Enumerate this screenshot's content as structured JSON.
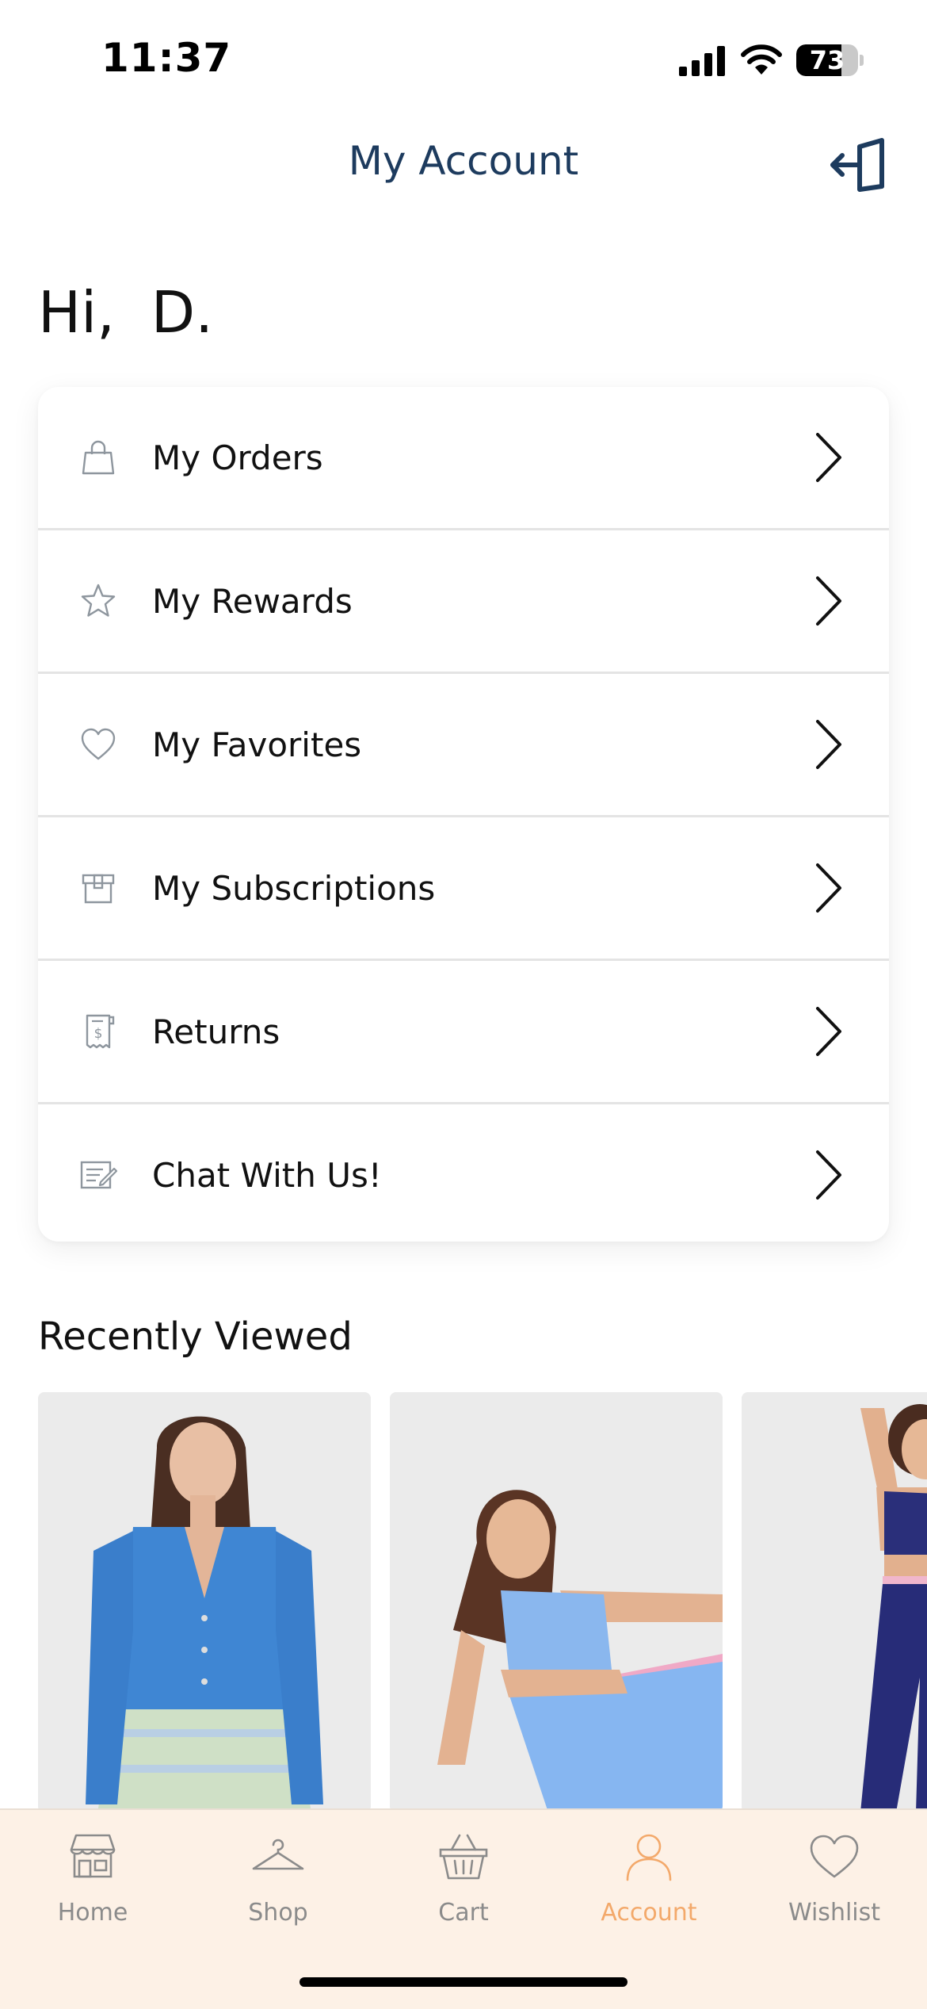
{
  "status_bar": {
    "time": "11:37",
    "battery_level": "73",
    "battery_fraction": 0.73
  },
  "header": {
    "title": "My Account",
    "logout_icon": "logout-icon"
  },
  "greeting": "Hi,  D.",
  "menu": {
    "items": [
      {
        "label": "My Orders",
        "icon": "shopping-bag-icon"
      },
      {
        "label": "My Rewards",
        "icon": "star-icon"
      },
      {
        "label": "My Favorites",
        "icon": "heart-icon"
      },
      {
        "label": "My Subscriptions",
        "icon": "box-icon"
      },
      {
        "label": "Returns",
        "icon": "receipt-icon"
      },
      {
        "label": "Chat With Us!",
        "icon": "chat-form-icon"
      }
    ]
  },
  "recently_viewed": {
    "title": "Recently Viewed",
    "products": [
      {
        "image": "product-blue-cardigan"
      },
      {
        "image": "product-light-blue-activewear"
      },
      {
        "image": "product-navy-activewear"
      }
    ]
  },
  "tab_bar": {
    "active": "Account",
    "tabs": [
      {
        "label": "Home",
        "icon": "storefront-icon"
      },
      {
        "label": "Shop",
        "icon": "hanger-icon"
      },
      {
        "label": "Cart",
        "icon": "basket-icon"
      },
      {
        "label": "Account",
        "icon": "person-icon"
      },
      {
        "label": "Wishlist",
        "icon": "heart-icon"
      }
    ]
  },
  "colors": {
    "header_text": "#1d3b5e",
    "tab_bar_bg": "#fdf1e6",
    "tab_active": "#f3a96b",
    "tab_inactive": "#8b8b8b",
    "icon_gray": "#8e969e"
  }
}
